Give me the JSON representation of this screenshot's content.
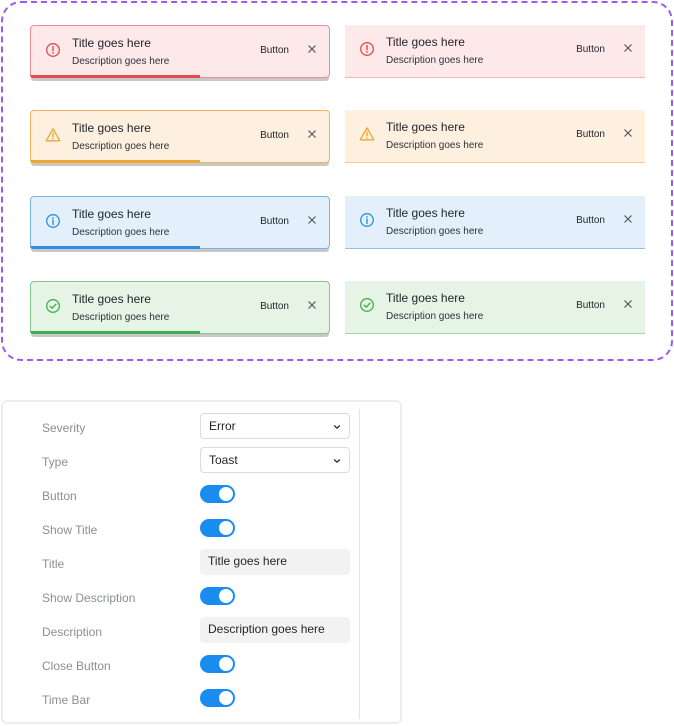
{
  "toasts": [
    {
      "severity": "error",
      "type": "toast",
      "icon": "error-circle-icon",
      "title": "Title goes here",
      "description": "Description goes here",
      "button": "Button",
      "time_bar": true,
      "color": "#e5484d"
    },
    {
      "severity": "error",
      "type": "inline",
      "icon": "error-circle-icon",
      "title": "Title goes here",
      "description": "Description goes here",
      "button": "Button",
      "time_bar": false,
      "color": "#e5484d"
    },
    {
      "severity": "warning",
      "type": "toast",
      "icon": "warning-triangle-icon",
      "title": "Title goes here",
      "description": "Description goes here",
      "button": "Button",
      "time_bar": true,
      "color": "#f0a630"
    },
    {
      "severity": "warning",
      "type": "inline",
      "icon": "warning-triangle-icon",
      "title": "Title goes here",
      "description": "Description goes here",
      "button": "Button",
      "time_bar": false,
      "color": "#f0a630"
    },
    {
      "severity": "info",
      "type": "toast",
      "icon": "info-circle-icon",
      "title": "Title goes here",
      "description": "Description goes here",
      "button": "Button",
      "time_bar": true,
      "color": "#2e8ee0"
    },
    {
      "severity": "info",
      "type": "inline",
      "icon": "info-circle-icon",
      "title": "Title goes here",
      "description": "Description goes here",
      "button": "Button",
      "time_bar": false,
      "color": "#2e8ee0"
    },
    {
      "severity": "success",
      "type": "toast",
      "icon": "check-circle-icon",
      "title": "Title goes here",
      "description": "Description goes here",
      "button": "Button",
      "time_bar": true,
      "color": "#3fae4f"
    },
    {
      "severity": "success",
      "type": "inline",
      "icon": "check-circle-icon",
      "title": "Title goes here",
      "description": "Description goes here",
      "button": "Button",
      "time_bar": false,
      "color": "#3fae4f"
    }
  ],
  "close_icon": "close-icon",
  "panel": {
    "severity": {
      "label": "Severity",
      "value": "Error"
    },
    "type": {
      "label": "Type",
      "value": "Toast"
    },
    "button": {
      "label": "Button",
      "on": true
    },
    "show_title": {
      "label": "Show Title",
      "on": true
    },
    "title": {
      "label": "Title",
      "value": "Title goes here"
    },
    "show_description": {
      "label": "Show Description",
      "on": true
    },
    "description": {
      "label": "Description",
      "value": "Description goes here"
    },
    "close_button": {
      "label": "Close Button",
      "on": true
    },
    "time_bar": {
      "label": "Time Bar",
      "on": true
    }
  },
  "colors": {
    "accent": "#1a8cf0",
    "frame": "#9a5cf0"
  }
}
